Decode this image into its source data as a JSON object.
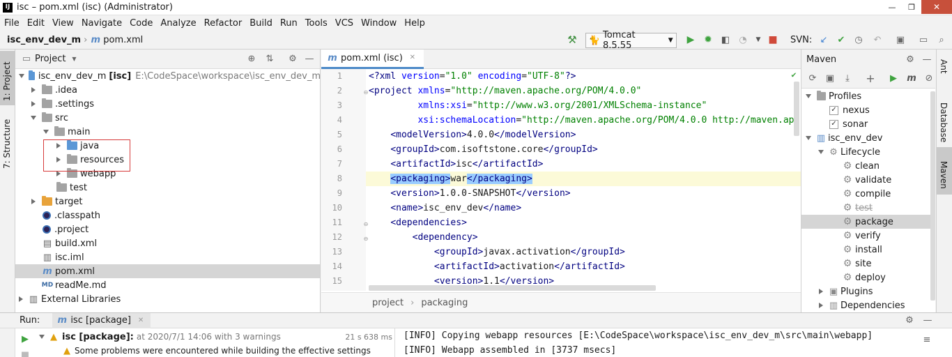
{
  "window": {
    "title": "isc – pom.xml (isc) (Administrator)",
    "controls": [
      "—",
      "❐",
      "✕"
    ]
  },
  "menu": [
    "File",
    "Edit",
    "View",
    "Navigate",
    "Code",
    "Analyze",
    "Refactor",
    "Build",
    "Run",
    "Tools",
    "VCS",
    "Window",
    "Help"
  ],
  "breadcrumb": {
    "project": "isc_env_dev_m",
    "file": "pom.xml"
  },
  "toolbar": {
    "run_config": "Tomcat 8.5.55",
    "svn_label": "SVN:"
  },
  "project_panel": {
    "title": "Project",
    "items": [
      {
        "label": "isc_env_dev_m",
        "bold_suffix": "[isc]",
        "path": "E:\\CodeSpace\\workspace\\isc_env_dev_m"
      },
      {
        "label": ".idea"
      },
      {
        "label": ".settings"
      },
      {
        "label": "src"
      },
      {
        "label": "main"
      },
      {
        "label": "java"
      },
      {
        "label": "resources"
      },
      {
        "label": "webapp"
      },
      {
        "label": "test"
      },
      {
        "label": "target"
      },
      {
        "label": ".classpath"
      },
      {
        "label": ".project"
      },
      {
        "label": "build.xml"
      },
      {
        "label": "isc.iml"
      },
      {
        "label": "pom.xml"
      },
      {
        "label": "readMe.md"
      },
      {
        "label": "External Libraries"
      }
    ]
  },
  "side_left_tabs": {
    "project": "1: Project",
    "structure": "7: Structure"
  },
  "side_right_tabs": {
    "ant": "Ant",
    "database": "Database",
    "maven": "Maven"
  },
  "editor": {
    "tab": "pom.xml (isc)",
    "line_numbers": [
      "1",
      "2",
      "3",
      "4",
      "5",
      "6",
      "7",
      "8",
      "9",
      "10",
      "11",
      "12",
      "13",
      "14",
      "15"
    ],
    "lines": [
      "<?xml version=\"1.0\" encoding=\"UTF-8\"?>",
      "<project xmlns=\"http://maven.apache.org/POM/4.0.0\"",
      "         xmlns:xsi=\"http://www.w3.org/2001/XMLSchema-instance\"",
      "         xsi:schemaLocation=\"http://maven.apache.org/POM/4.0.0 http://maven.ap",
      "    <modelVersion>4.0.0</modelVersion>",
      "    <groupId>com.isoftstone.core</groupId>",
      "    <artifactId>isc</artifactId>",
      "    <packaging>war</packaging>",
      "    <version>1.0.0-SNAPSHOT</version>",
      "    <name>isc_env_dev</name>",
      "    <dependencies>",
      "        <dependency>",
      "            <groupId>javax.activation</groupId>",
      "            <artifactId>activation</artifactId>",
      "            <version>1.1</version>"
    ],
    "status_crumbs": [
      "project",
      "packaging"
    ]
  },
  "maven_panel": {
    "title": "Maven",
    "items": [
      {
        "label": "Profiles"
      },
      {
        "label": "nexus"
      },
      {
        "label": "sonar"
      },
      {
        "label": "isc_env_dev"
      },
      {
        "label": "Lifecycle"
      },
      {
        "label": "clean"
      },
      {
        "label": "validate"
      },
      {
        "label": "compile"
      },
      {
        "label": "test"
      },
      {
        "label": "package"
      },
      {
        "label": "verify"
      },
      {
        "label": "install"
      },
      {
        "label": "site"
      },
      {
        "label": "deploy"
      },
      {
        "label": "Plugins"
      },
      {
        "label": "Dependencies"
      }
    ]
  },
  "run_panel": {
    "label": "Run:",
    "tab": "isc [package]",
    "task": "isc [package]:",
    "task_time": "at 2020/7/1 14:06 with 3 warnings",
    "duration": "21 s 638 ms",
    "warning": "Some problems were encountered while building the effective settings",
    "console": [
      "[INFO] Copying webapp resources [E:\\CodeSpace\\workspace\\isc_env_dev_m\\src\\main\\webapp]",
      "[INFO] Webapp assembled in [3737 msecs]"
    ]
  }
}
